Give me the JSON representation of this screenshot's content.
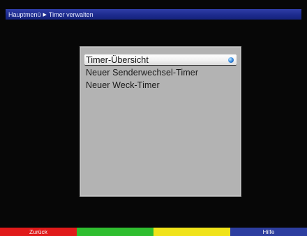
{
  "header": {
    "crumb_root": "Hauptmenü",
    "crumb_current": "Timer verwalten"
  },
  "menu": {
    "items": [
      {
        "label": "Timer-Übersicht",
        "selected": true
      },
      {
        "label": "Neuer Senderwechsel-Timer",
        "selected": false
      },
      {
        "label": "Neuer Weck-Timer",
        "selected": false
      }
    ]
  },
  "footer": {
    "buttons": [
      {
        "label": "Zurück",
        "color": "red"
      },
      {
        "label": "",
        "color": "green"
      },
      {
        "label": "",
        "color": "yellow"
      },
      {
        "label": "Hilfe",
        "color": "blue"
      }
    ]
  },
  "colors": {
    "header": "#1c2a8c",
    "menu_bg": "#b3b3b3",
    "red": "#e11a1a",
    "green": "#2fbe2f",
    "yellow": "#f0e31a",
    "blue": "#2d3ea0"
  },
  "icons": {
    "breadcrumb_separator": "triangle-right-icon",
    "selected_indicator": "blue-dot-icon"
  }
}
